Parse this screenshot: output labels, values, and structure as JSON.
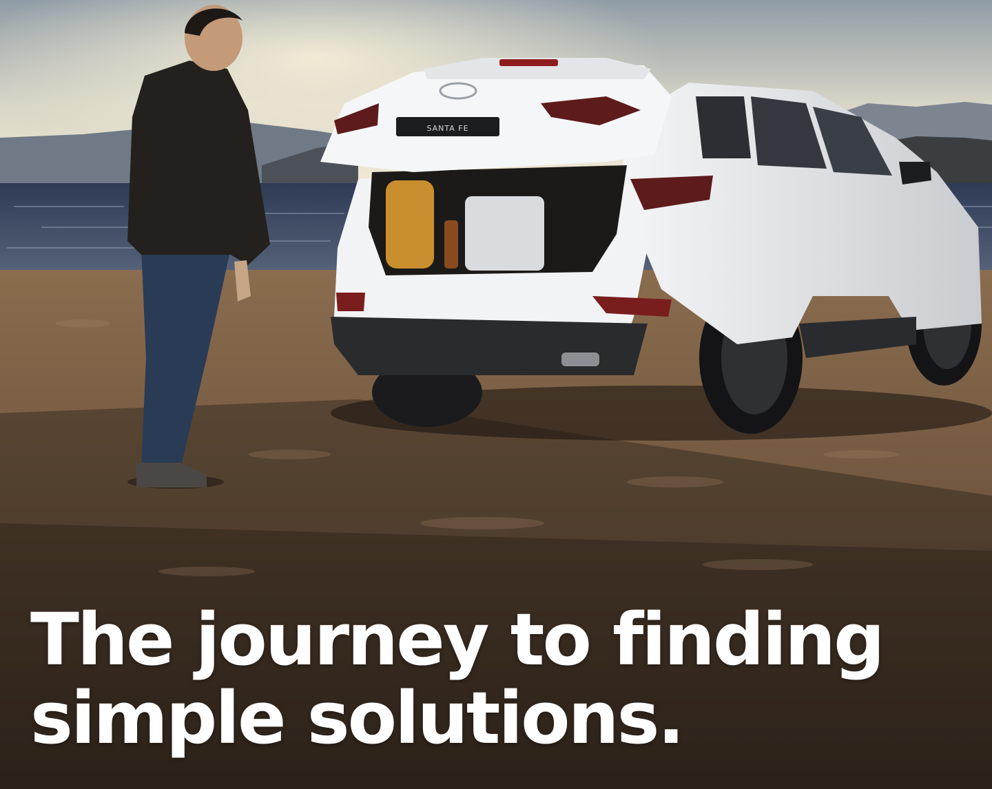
{
  "headline": {
    "line1": "The journey to finding",
    "line2": "simple solutions."
  },
  "vehicle": {
    "badge_text": "SANTA FE"
  },
  "colors": {
    "sky_top": "#9aa6ae",
    "sky_bottom": "#f0ead9",
    "water": "#3d4a63",
    "sand": "#7a5f44",
    "car_body": "#eef0f2",
    "headline": "#ffffff"
  }
}
